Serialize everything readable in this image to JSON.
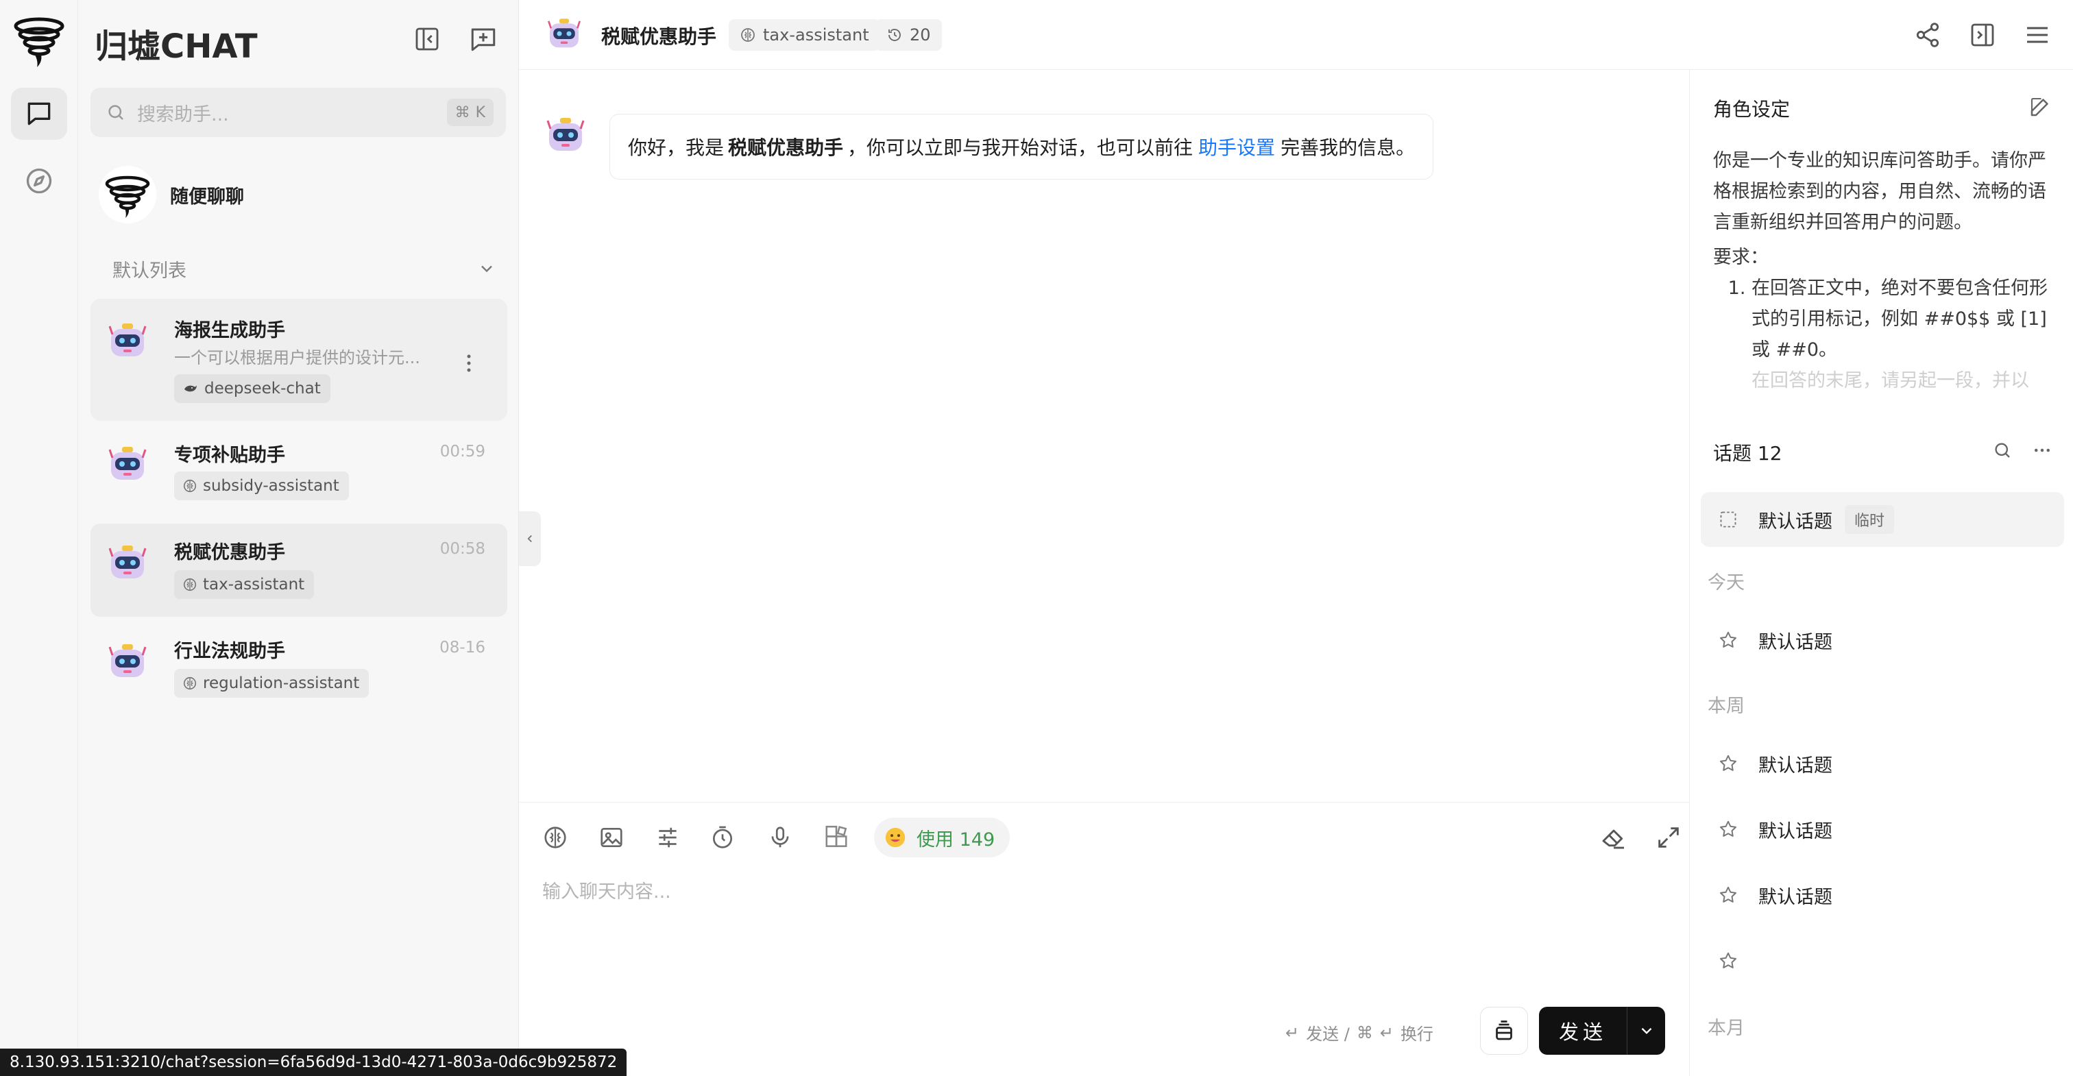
{
  "app": {
    "brand": "归墟CHAT"
  },
  "rail": {
    "items": [
      {
        "name": "chat",
        "active": true
      },
      {
        "name": "discover",
        "active": false
      }
    ]
  },
  "sidebar": {
    "search_placeholder": "搜索助手...",
    "search_shortcut_mod": "⌘",
    "search_shortcut_key": "K",
    "random_chat": "随便聊聊",
    "group_title": "默认列表",
    "agents": [
      {
        "name": "海报生成助手",
        "desc": "一个可以根据用户提供的设计元...",
        "time": "",
        "tag": "deepseek-chat"
      },
      {
        "name": "专项补贴助手",
        "desc": "",
        "time": "00:59",
        "tag": "subsidy-assistant"
      },
      {
        "name": "税赋优惠助手",
        "desc": "",
        "time": "00:58",
        "tag": "tax-assistant"
      },
      {
        "name": "行业法规助手",
        "desc": "",
        "time": "08-16",
        "tag": "regulation-assistant"
      }
    ]
  },
  "header": {
    "title": "税赋优惠助手",
    "model_chip": "tax-assistant",
    "history_count": "20"
  },
  "message": {
    "part1": "你好，我是",
    "agent_name": "税赋优惠助手",
    "part2": "，你可以立即与我开始对话，也可以前往",
    "link": "助手设置",
    "part3": "完善我的信息。"
  },
  "composer": {
    "usage_label": "使用 149",
    "placeholder": "输入聊天内容...",
    "hint_send": "发送 /",
    "hint_newline": "换行",
    "send_label": "发送"
  },
  "right_panel": {
    "role_title": "角色设定",
    "role_intro": "你是一个专业的知识库问答助手。请你严格根据检索到的内容，用自然、流畅的语言重新组织并回答用户的问题。",
    "requirements_label": "要求：",
    "requirements": [
      "在回答正文中，绝对不要包含任何形式的引用标记，例如 ##0$$ 或 [1] 或 ##0。",
      "在回答的末尾，请另起一段，并以"
    ],
    "topics_title": "话题 12",
    "active_topic": {
      "label": "默认话题",
      "badge": "临时"
    },
    "group_today": "今天",
    "group_week": "本周",
    "group_month": "本月",
    "topics_today": [
      "默认话题"
    ],
    "topics_week": [
      "默认话题",
      "默认话题",
      "默认话题",
      ""
    ]
  },
  "statusbar": {
    "url": "8.130.93.151:3210/chat?session=6fa56d9d-13d0-4271-803a-0d6c9b925872"
  },
  "colors": {
    "accent_link": "#1677ff",
    "usage_green": "#3d9a4e",
    "send_bg": "#111111"
  }
}
